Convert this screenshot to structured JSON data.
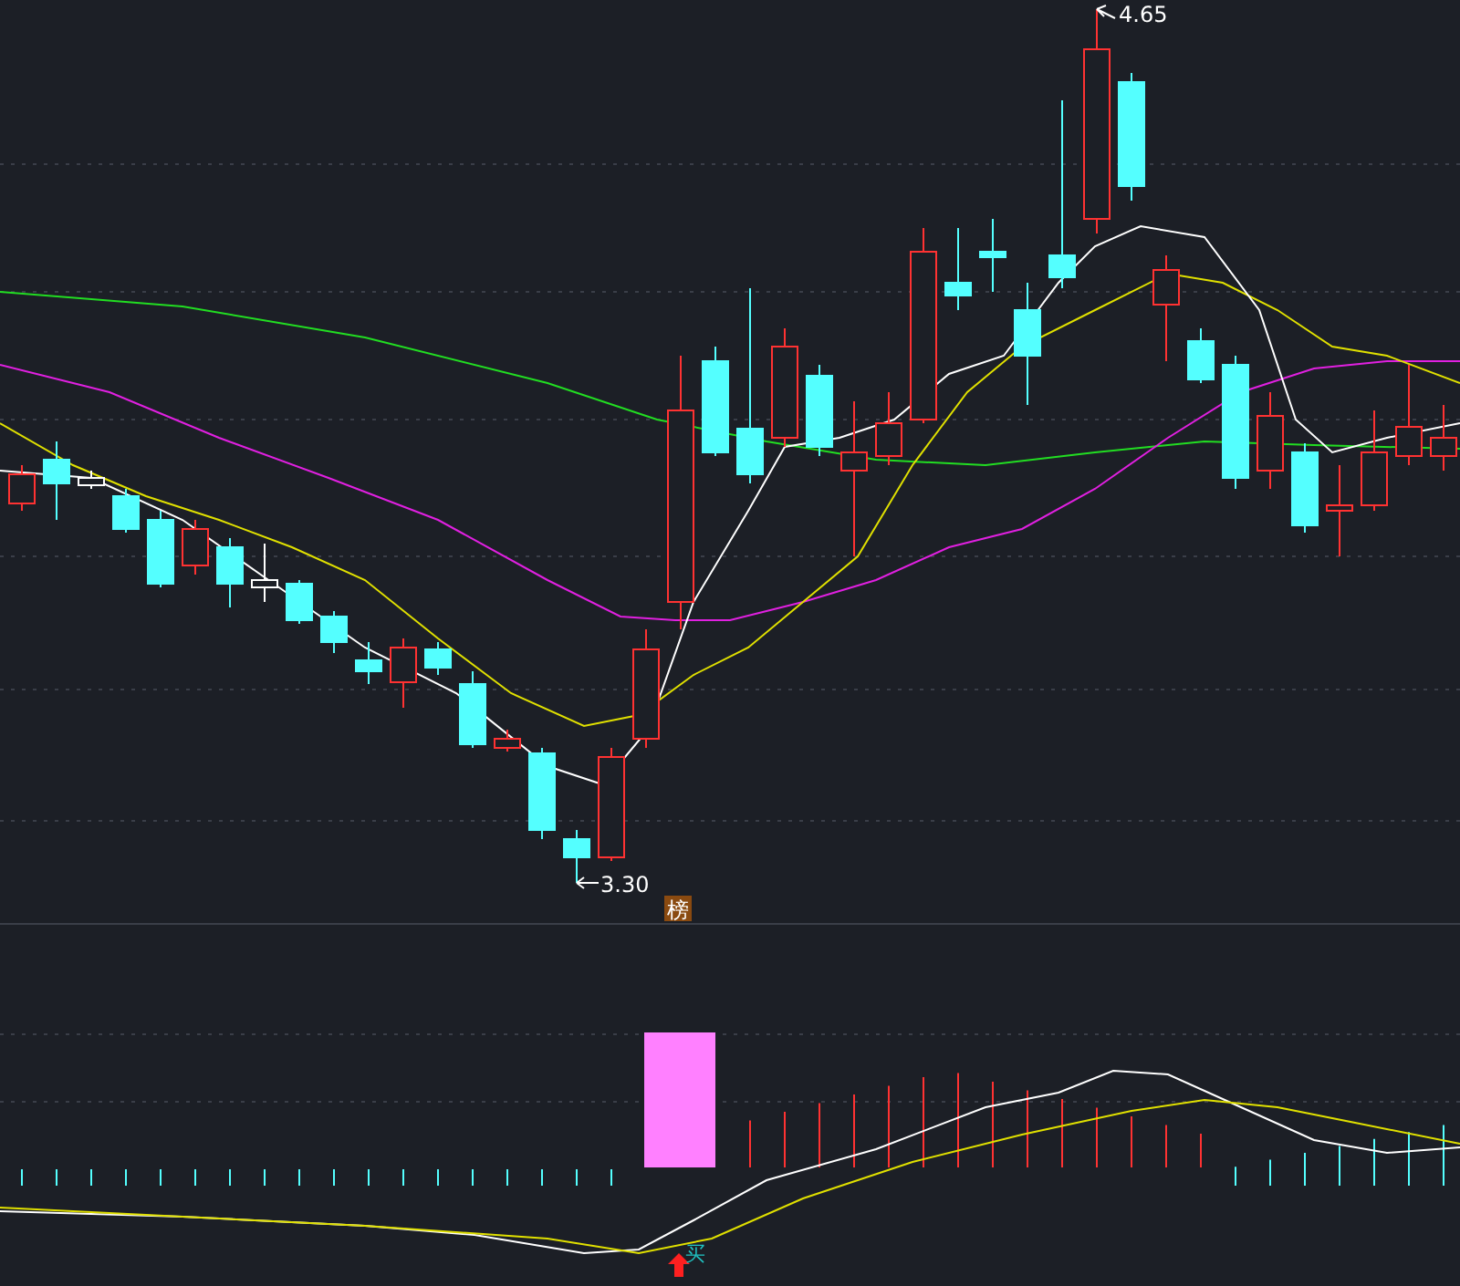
{
  "main_chart": {
    "high_label": "4.65",
    "low_label": "3.30",
    "badge": "榜"
  },
  "indicator": {
    "signal": "买"
  }
}
